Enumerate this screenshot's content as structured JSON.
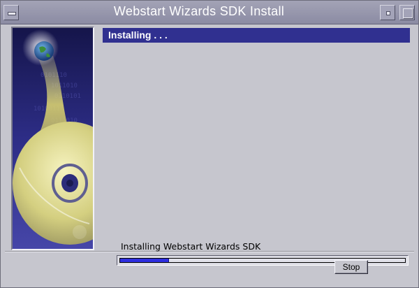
{
  "window": {
    "title": "Webstart Wizards SDK Install"
  },
  "header": {
    "title": "Installing . . ."
  },
  "progress": {
    "label": "Installing Webstart Wizards SDK",
    "value_percent": 17
  },
  "buttons": {
    "stop": "Stop"
  },
  "colors": {
    "header_bg": "#303090",
    "progress_fill": "#2e2ee0",
    "titlebar": "#9393ab"
  },
  "icons": {
    "window_menu": "window-menu-icon",
    "minimize": "minimize-icon",
    "maximize": "maximize-icon"
  }
}
